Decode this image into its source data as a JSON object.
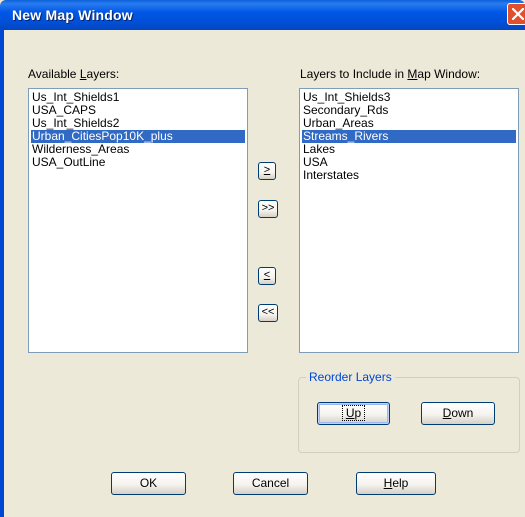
{
  "window": {
    "title": "New Map Window"
  },
  "available": {
    "label_pre": "Available ",
    "label_accel": "L",
    "label_post": "ayers:",
    "items": [
      {
        "label": "Us_Int_Shields1",
        "selected": false
      },
      {
        "label": "USA_CAPS",
        "selected": false
      },
      {
        "label": "Us_Int_Shields2",
        "selected": false
      },
      {
        "label": "Urban_CitiesPop10K_plus",
        "selected": true
      },
      {
        "label": "Wilderness_Areas",
        "selected": false
      },
      {
        "label": "USA_OutLine",
        "selected": false
      }
    ]
  },
  "include": {
    "label_pre": "Layers to Include in ",
    "label_accel": "M",
    "label_post": "ap Window:",
    "items": [
      {
        "label": "Us_Int_Shields3",
        "selected": false
      },
      {
        "label": "Secondary_Rds",
        "selected": false
      },
      {
        "label": "Urban_Areas",
        "selected": false
      },
      {
        "label": "Streams_Rivers",
        "selected": true
      },
      {
        "label": "Lakes",
        "selected": false
      },
      {
        "label": "USA",
        "selected": false
      },
      {
        "label": "Interstates",
        "selected": false
      }
    ]
  },
  "transfer": {
    "add_one": ">",
    "add_all": ">>",
    "remove_one": "<",
    "remove_all": "<<"
  },
  "reorder": {
    "title": "Reorder Layers",
    "up_accel": "U",
    "up_rest": "p",
    "down_accel": "D",
    "down_rest": "own"
  },
  "footer": {
    "ok": "OK",
    "cancel": "Cancel",
    "help_accel": "H",
    "help_rest": "elp"
  },
  "colors": {
    "title_bar": "#0058e6",
    "selection": "#316ac5",
    "dialog_bg": "#ece9d8",
    "close_button": "#e0502f"
  }
}
